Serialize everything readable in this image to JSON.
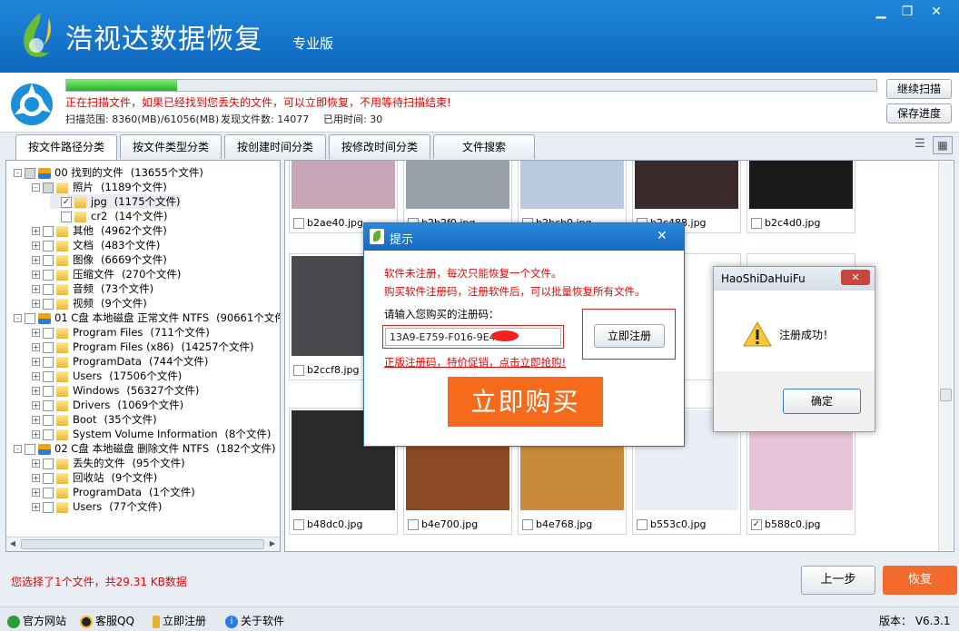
{
  "app": {
    "title": "浩视达数据恢复",
    "edition": "专业版"
  },
  "window_controls": [
    "minimize-icon",
    "restore-icon",
    "close-icon"
  ],
  "scan": {
    "progress_percent": 13.7,
    "message": "正在扫描文件，如果已经找到您丢失的文件，可以立即恢复，不用等待扫描结束!",
    "range": "扫描范围: 8360(MB)/61056(MB)",
    "found": "发现文件数: 14077",
    "elapsed": "已用时间: 30",
    "continue_label": "继续扫描",
    "save_label": "保存进度"
  },
  "tabs": [
    "按文件路径分类",
    "按文件类型分类",
    "按创建时间分类",
    "按修改时间分类",
    "文件搜索"
  ],
  "tree": [
    {
      "level": 0,
      "expander": "-",
      "check": "partial",
      "icon": "found",
      "name": "00 找到的文件",
      "count": "(13655个文件)"
    },
    {
      "level": 1,
      "expander": "-",
      "check": "partial",
      "icon": "folder",
      "name": "照片",
      "count": "(1189个文件)"
    },
    {
      "level": 2,
      "expander": "",
      "check": "checked",
      "icon": "folder",
      "name": "jpg",
      "count": "(1175个文件)",
      "selected": true
    },
    {
      "level": 2,
      "expander": "",
      "check": "none",
      "icon": "folder",
      "name": "cr2",
      "count": "(14个文件)"
    },
    {
      "level": 1,
      "expander": "+",
      "check": "none",
      "icon": "folder",
      "name": "其他",
      "count": "(4962个文件)"
    },
    {
      "level": 1,
      "expander": "+",
      "check": "none",
      "icon": "folder",
      "name": "文档",
      "count": "(483个文件)"
    },
    {
      "level": 1,
      "expander": "+",
      "check": "none",
      "icon": "folder",
      "name": "图像",
      "count": "(6669个文件)"
    },
    {
      "level": 1,
      "expander": "+",
      "check": "none",
      "icon": "folder",
      "name": "压缩文件",
      "count": "(270个文件)"
    },
    {
      "level": 1,
      "expander": "+",
      "check": "none",
      "icon": "folder",
      "name": "音频",
      "count": "(73个文件)"
    },
    {
      "level": 1,
      "expander": "+",
      "check": "none",
      "icon": "folder",
      "name": "视频",
      "count": "(9个文件)"
    },
    {
      "level": 0,
      "expander": "-",
      "check": "none",
      "icon": "drive",
      "name": "01 C盘 本地磁盘 正常文件 NTFS",
      "count": "(90661个文件"
    },
    {
      "level": 1,
      "expander": "+",
      "check": "none",
      "icon": "folder",
      "name": "Program Files",
      "count": "(711个文件)"
    },
    {
      "level": 1,
      "expander": "+",
      "check": "none",
      "icon": "folder",
      "name": "Program Files (x86)",
      "count": "(14257个文件)"
    },
    {
      "level": 1,
      "expander": "+",
      "check": "none",
      "icon": "folder",
      "name": "ProgramData",
      "count": "(744个文件)"
    },
    {
      "level": 1,
      "expander": "+",
      "check": "none",
      "icon": "folder",
      "name": "Users",
      "count": "(17506个文件)"
    },
    {
      "level": 1,
      "expander": "+",
      "check": "none",
      "icon": "folder",
      "name": "Windows",
      "count": "(56327个文件)"
    },
    {
      "level": 1,
      "expander": "+",
      "check": "none",
      "icon": "folder",
      "name": "Drivers",
      "count": "(1069个文件)"
    },
    {
      "level": 1,
      "expander": "+",
      "check": "none",
      "icon": "folder",
      "name": "Boot",
      "count": "(35个文件)"
    },
    {
      "level": 1,
      "expander": "+",
      "check": "none",
      "icon": "folder",
      "name": "System Volume Information",
      "count": "(8个文件)"
    },
    {
      "level": 0,
      "expander": "-",
      "check": "none",
      "icon": "drive",
      "name": "02 C盘 本地磁盘 删除文件 NTFS",
      "count": "(182个文件)"
    },
    {
      "level": 1,
      "expander": "+",
      "check": "none",
      "icon": "folder",
      "name": "丢失的文件",
      "count": "(95个文件)"
    },
    {
      "level": 1,
      "expander": "+",
      "check": "none",
      "icon": "folder",
      "name": "回收站",
      "count": "(9个文件)"
    },
    {
      "level": 1,
      "expander": "+",
      "check": "none",
      "icon": "folder",
      "name": "ProgramData",
      "count": "(1个文件)"
    },
    {
      "level": 1,
      "expander": "+",
      "check": "none",
      "icon": "folder",
      "name": "Users",
      "count": "(77个文件)"
    }
  ],
  "thumbnails": [
    {
      "name": "b2ae40.jpg",
      "checked": false,
      "color": "#c7a6b8"
    },
    {
      "name": "b2b2f0.jpg",
      "checked": false,
      "color": "#9aa0a8"
    },
    {
      "name": "b2bcb0.jpg",
      "checked": false,
      "color": "#b9c9df"
    },
    {
      "name": "b2c488.jpg",
      "checked": false,
      "color": "#3a2a2a"
    },
    {
      "name": "b2c4d0.jpg",
      "checked": false,
      "color": "#1a1a1a"
    },
    {
      "name": "b2ccf8.jpg",
      "checked": false,
      "color": "#4a4a4e"
    },
    {
      "name": "",
      "checked": false,
      "color": "#ffffff"
    },
    {
      "name": "",
      "checked": false,
      "color": "#ffffff"
    },
    {
      "name": "",
      "checked": false,
      "color": "#ffffff"
    },
    {
      "name": "",
      "checked": false,
      "color": "#ffffff"
    },
    {
      "name": "b48dc0.jpg",
      "checked": false,
      "color": "#2b2b2b"
    },
    {
      "name": "b4e700.jpg",
      "checked": false,
      "color": "#8b4a23"
    },
    {
      "name": "b4e768.jpg",
      "checked": false,
      "color": "#c98a3c"
    },
    {
      "name": "b553c0.jpg",
      "checked": false,
      "color": "#e9eef7"
    },
    {
      "name": "b588c0.jpg",
      "checked": true,
      "color": "#e8c4d8"
    }
  ],
  "status": "您选择了1个文件，共29.31 KB数据",
  "nav": {
    "prev_label": "上一步",
    "recover_label": "恢复"
  },
  "footer": {
    "links": [
      "官方网站",
      "客服QQ",
      "立即注册",
      "关于软件"
    ],
    "version": "版本：  V6.3.1"
  },
  "dialog": {
    "title": "提示",
    "line1": "软件未注册，每次只能恢复一个文件。",
    "line2": "购买软件注册码，注册软件后，可以批量恢复所有文件。",
    "prompt": "请输入您购买的注册码：",
    "serial": "13A9-E759-F016-9E49-0",
    "register_label": "立即注册",
    "promo": "正版注册码，特价促销，点击立即抢购!",
    "buy_label": "立即购买"
  },
  "msgbox": {
    "title": "HaoShiDaHuiFu",
    "text": "注册成功！",
    "ok_label": "确定"
  }
}
